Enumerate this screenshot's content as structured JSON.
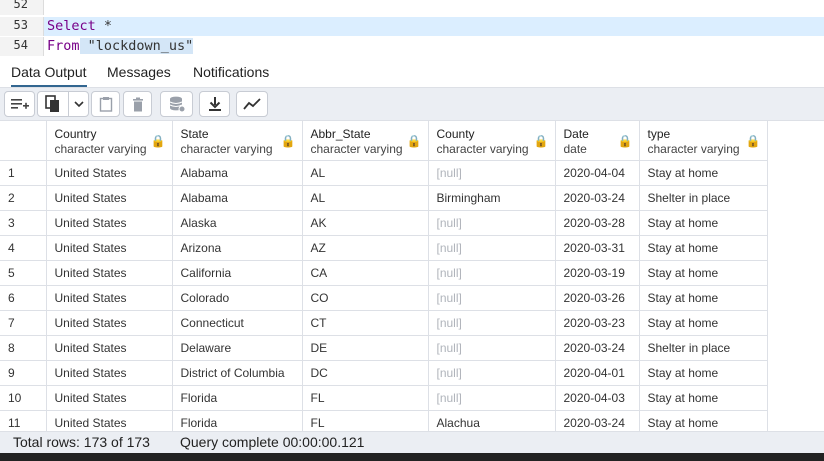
{
  "editor": {
    "lines": [
      {
        "num": "52",
        "keyword": "",
        "rest": ""
      },
      {
        "num": "53",
        "keyword": "Select",
        "rest": " *"
      },
      {
        "num": "54",
        "keyword": "From",
        "rest": " \"lockdown_us\""
      }
    ]
  },
  "tabs": [
    "Data Output",
    "Messages",
    "Notifications"
  ],
  "toolbar": {
    "buttons": [
      "add-row-icon",
      "copy-icon",
      "chevron-down-icon",
      "paste-icon",
      "delete-icon",
      "save-data-icon",
      "download-icon",
      "graph-icon"
    ]
  },
  "grid": {
    "columns": [
      {
        "name": "Country",
        "type": "character varying"
      },
      {
        "name": "State",
        "type": "character varying"
      },
      {
        "name": "Abbr_State",
        "type": "character varying"
      },
      {
        "name": "County",
        "type": "character varying"
      },
      {
        "name": "Date",
        "type": "date"
      },
      {
        "name": "type",
        "type": "character varying"
      }
    ],
    "rows": [
      [
        "1",
        "United States",
        "Alabama",
        "AL",
        "[null]",
        "2020-04-04",
        "Stay at home"
      ],
      [
        "2",
        "United States",
        "Alabama",
        "AL",
        "Birmingham",
        "2020-03-24",
        "Shelter in place"
      ],
      [
        "3",
        "United States",
        "Alaska",
        "AK",
        "[null]",
        "2020-03-28",
        "Stay at home"
      ],
      [
        "4",
        "United States",
        "Arizona",
        "AZ",
        "[null]",
        "2020-03-31",
        "Stay at home"
      ],
      [
        "5",
        "United States",
        "California",
        "CA",
        "[null]",
        "2020-03-19",
        "Stay at home"
      ],
      [
        "6",
        "United States",
        "Colorado",
        "CO",
        "[null]",
        "2020-03-26",
        "Stay at home"
      ],
      [
        "7",
        "United States",
        "Connecticut",
        "CT",
        "[null]",
        "2020-03-23",
        "Stay at home"
      ],
      [
        "8",
        "United States",
        "Delaware",
        "DE",
        "[null]",
        "2020-03-24",
        "Shelter in place"
      ],
      [
        "9",
        "United States",
        "District of Columbia",
        "DC",
        "[null]",
        "2020-04-01",
        "Stay at home"
      ],
      [
        "10",
        "United States",
        "Florida",
        "FL",
        "[null]",
        "2020-04-03",
        "Stay at home"
      ],
      [
        "11",
        "United States",
        "Florida",
        "FL",
        "Alachua",
        "2020-03-24",
        "Stay at home"
      ]
    ]
  },
  "status": {
    "total_rows": "Total rows: 173 of 173",
    "query": "Query complete 00:00:00.121"
  }
}
